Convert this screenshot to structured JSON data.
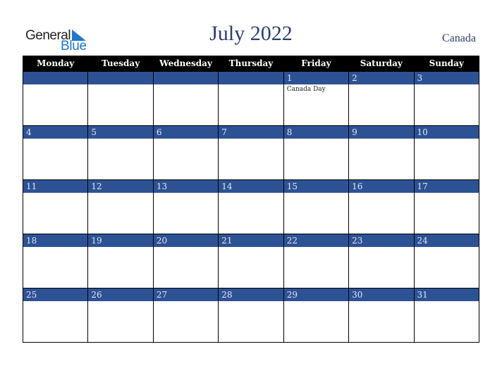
{
  "logo": {
    "word1": "General",
    "word2": "Blue"
  },
  "header": {
    "title": "July 2022",
    "country": "Canada"
  },
  "weekdays": [
    "Monday",
    "Tuesday",
    "Wednesday",
    "Thursday",
    "Friday",
    "Saturday",
    "Sunday"
  ],
  "weeks": [
    [
      {
        "day": ""
      },
      {
        "day": ""
      },
      {
        "day": ""
      },
      {
        "day": ""
      },
      {
        "day": "1",
        "event": "Canada Day"
      },
      {
        "day": "2"
      },
      {
        "day": "3"
      }
    ],
    [
      {
        "day": "4"
      },
      {
        "day": "5"
      },
      {
        "day": "6"
      },
      {
        "day": "7"
      },
      {
        "day": "8"
      },
      {
        "day": "9"
      },
      {
        "day": "10"
      }
    ],
    [
      {
        "day": "11"
      },
      {
        "day": "12"
      },
      {
        "day": "13"
      },
      {
        "day": "14"
      },
      {
        "day": "15"
      },
      {
        "day": "16"
      },
      {
        "day": "17"
      }
    ],
    [
      {
        "day": "18"
      },
      {
        "day": "19"
      },
      {
        "day": "20"
      },
      {
        "day": "21"
      },
      {
        "day": "22"
      },
      {
        "day": "23"
      },
      {
        "day": "24"
      }
    ],
    [
      {
        "day": "25"
      },
      {
        "day": "26"
      },
      {
        "day": "27"
      },
      {
        "day": "28"
      },
      {
        "day": "29"
      },
      {
        "day": "30"
      },
      {
        "day": "31"
      }
    ]
  ],
  "colors": {
    "band": "#2d5294",
    "header_bg": "#000000",
    "title": "#2a3f6b",
    "logo_blue": "#1f78c8"
  }
}
